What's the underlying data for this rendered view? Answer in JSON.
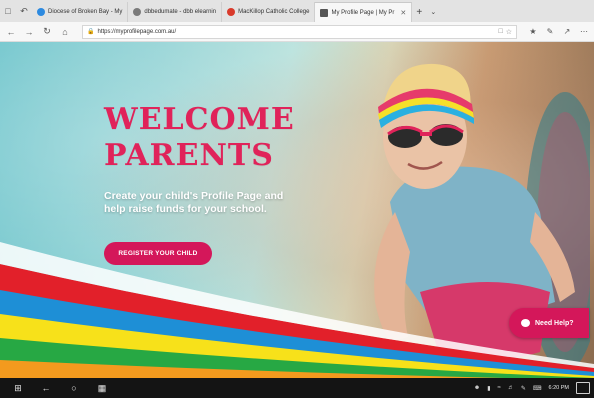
{
  "browser": {
    "tabs": [
      {
        "label": "Diocese of Broken Bay - My",
        "favicon_color": "#2d8ae0"
      },
      {
        "label": "dbbedumate - dbb elearnin",
        "favicon_color": "#7a7a7a"
      },
      {
        "label": "MacKillop Catholic College",
        "favicon_color": "#d93a2b"
      },
      {
        "label": "My Profile Page | My Pr",
        "favicon_color": "#555555"
      }
    ],
    "address": "https://myprofilepage.com.au/"
  },
  "hero": {
    "heading_line1": "WELCOME",
    "heading_line2": "PARENTS",
    "subtext": "Create your child's Profile Page and help raise funds for your school.",
    "register_label": "REGISTER YOUR CHILD",
    "help_label": "Need Help?"
  },
  "colors": {
    "brand_pink": "#e0235a",
    "button_pink": "#d4175a",
    "stripe_red": "#e2202a",
    "stripe_blue": "#1e8fd6",
    "stripe_yellow": "#f7e11a",
    "stripe_green": "#27a844",
    "stripe_orange": "#f39a1e"
  },
  "taskbar": {
    "time": "6:20 PM"
  }
}
